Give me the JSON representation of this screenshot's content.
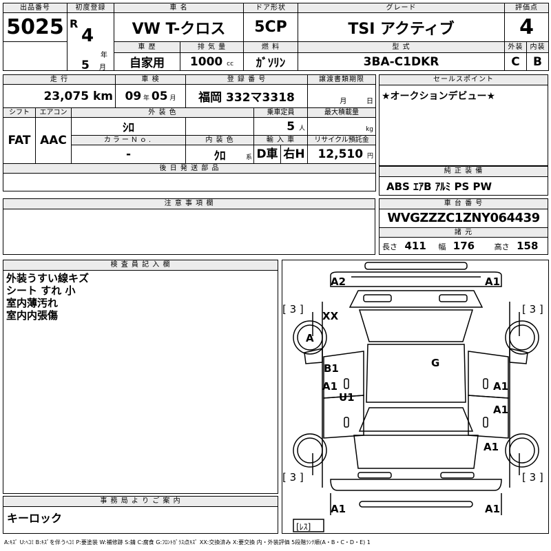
{
  "header": {
    "lot_label": "出品番号",
    "lot_number": "5025",
    "first_reg_label": "初度登録",
    "era": "R",
    "first_reg_year": "4",
    "year_unit": "年",
    "first_reg_month": "5",
    "month_unit": "月",
    "car_name_label": "車 名",
    "car_name": "VW T-クロス",
    "door_label": "ドア形状",
    "door": "5CP",
    "grade_label": "グレード",
    "grade": "TSI アクティブ",
    "score_label": "評価点",
    "score": "4",
    "history_label": "車 歴",
    "history": "自家用",
    "displacement_label": "排 気 量",
    "displacement": "1000",
    "cc_unit": "cc",
    "fuel_label": "燃 料",
    "fuel": "ｶﾞｿﾘﾝ",
    "model_label": "型 式",
    "model": "3BA-C1DKR",
    "exterior_label": "外装",
    "exterior_grade": "C",
    "interior_label": "内装",
    "interior_grade": "B"
  },
  "info": {
    "mileage_label": "走 行",
    "mileage": "23,075",
    "km_unit": "km",
    "inspection_label": "車 検",
    "insp_year": "09",
    "insp_month": "05",
    "plate_label": "登 録 番 号",
    "plate": "福岡 332マ3318",
    "transfer_label": "譲渡書類期限",
    "transfer_month_unit": "月",
    "transfer_day_unit": "日",
    "shift_label": "シフト",
    "shift": "FAT",
    "ac_label": "エアコン",
    "ac": "AAC",
    "ext_color_label": "外 装 色",
    "ext_color": "ｼﾛ",
    "capacity_label": "乗車定員",
    "capacity": "5",
    "capacity_unit": "人",
    "load_label": "最大積載量",
    "load_unit": "kg",
    "color_no_label": "カラーＮｏ.",
    "color_no": "-",
    "int_color_label": "内 装 色",
    "int_color": "ｸﾛ",
    "int_color_unit": "系",
    "import_label": "輸 入 車",
    "import_d": "D車",
    "import_side": "右H",
    "recycle_label": "リサイクル預託金",
    "recycle": "12,510",
    "recycle_unit": "円",
    "parts_label": "後 日 発 送 部 品"
  },
  "sales_point": {
    "label": "セールスポイント",
    "text": "★オークションデビュー★"
  },
  "equipment": {
    "label": "純 正 装 備",
    "text": "ABS ｴｱB ｱﾙﾐ PS PW"
  },
  "notes": {
    "label": "注 意 事 項 欄"
  },
  "vin": {
    "label": "車 台 番 号",
    "number": "WVGZZZC1ZNY064439",
    "dims_label": "諸 元",
    "length_label": "長さ",
    "length": "411",
    "width_label": "幅",
    "width": "176",
    "height_label": "高さ",
    "height": "158"
  },
  "inspector": {
    "label": "検 査 員 記 入 欄",
    "lines": [
      "外装うすい線キズ",
      "シート すれ 小",
      "室内薄汚れ",
      "室内内張傷"
    ]
  },
  "office": {
    "label": "事 務 局 よ り ご 案 内",
    "text": "キーロック"
  },
  "diagram_marks": {
    "a2_front_left": "A2",
    "a1_front_right": "A1",
    "tire_fl": "[ 3 ]",
    "tire_fr": "[ 3 ]",
    "tire_rl": "[ 3 ]",
    "tire_rr": "[ 3 ]",
    "xx_windshield": "XX",
    "a_fender_left": "A",
    "g_roof": "G",
    "b1_door_left": "B1",
    "a1_door_left": "A1",
    "u1_door_left": "U1",
    "a1_door_right_front": "A1",
    "a1_door_right_rear": "A1",
    "a1_quarter_right": "A1",
    "a1_rear_left": "A1",
    "a1_rear_right": "A1",
    "spare": "[ﾚｽ]"
  },
  "legend": "A:ｷｽﾞ U:ﾍｺﾐ B:ｷｽﾞを伴うﾍｺﾐ P:要塗装 W:補修跡 S:錆 C:腐食 G:ﾌﾛﾝﾄｶﾞﾗｽ点ｷｽﾞ XX:交換済み X:要交換 内・外装評価 5段階ﾗﾝｸ順(A・B・C・D・E) 1"
}
